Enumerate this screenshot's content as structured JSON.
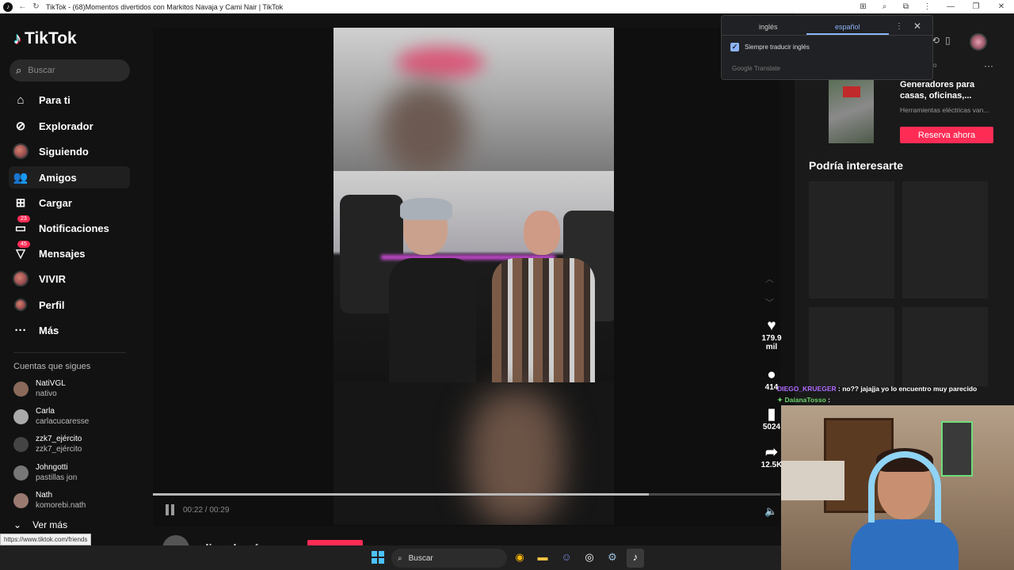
{
  "browser": {
    "title": "TikTok - (68)Momentos divertidos con Markitos Navaja y Cami Nair | TikTok",
    "status_url": "https://www.tiktok.com/friends"
  },
  "sidebar": {
    "brand": "TikTok",
    "search_placeholder": "Buscar",
    "nav": [
      {
        "label": "Para ti",
        "icon": "home-icon"
      },
      {
        "label": "Explorador",
        "icon": "compass-icon"
      },
      {
        "label": "Siguiendo",
        "icon": "avatar-icon"
      },
      {
        "label": "Amigos",
        "icon": "friends-icon"
      },
      {
        "label": "Cargar",
        "icon": "upload-icon"
      },
      {
        "label": "Notificaciones",
        "icon": "inbox-icon",
        "badge": "23"
      },
      {
        "label": "Mensajes",
        "icon": "messages-icon",
        "badge": "45"
      },
      {
        "label": "VIVIR",
        "icon": "live-icon"
      },
      {
        "label": "Perfil",
        "icon": "profile-icon"
      },
      {
        "label": "Más",
        "icon": "more-icon"
      }
    ],
    "following_heading": "Cuentas que sigues",
    "following": [
      {
        "name": "NatiVGL",
        "sub": "nativo"
      },
      {
        "name": "Carla",
        "sub": "carlacucaresse"
      },
      {
        "name": "zzk7_ejército",
        "sub": "zzk7_ejército"
      },
      {
        "name": "Johngotti",
        "sub": "pastillas jon"
      },
      {
        "name": "Nath",
        "sub": "komorebi.nath"
      }
    ],
    "see_more": "Ver más"
  },
  "player": {
    "time": "00:22 / 00:29",
    "progress": 0.79,
    "caption": "clips de cámara"
  },
  "actions": {
    "likes": "179.9\nmil",
    "likes_1": "179.9",
    "likes_2": "mil",
    "comments": "414",
    "saves": "5024",
    "shares": "12.5K"
  },
  "right": {
    "ad_title": "Generadores para casas, oficinas,...",
    "ad_subtitle": "Herramientas eléctricas van...",
    "ad_button": "Reserva ahora",
    "interest_heading": "Podría interesarte"
  },
  "translate": {
    "tab_source": "inglés",
    "tab_target": "español",
    "always": "Siempre traducir inglés",
    "footer": "Google Translate"
  },
  "chat": {
    "user1": "DIEGO_KRUEGER",
    "msg1": ": no?? jajajja yo lo encuentro muy parecido",
    "user2": "DaianaTosso",
    "msg2": ":"
  },
  "taskbar": {
    "search_placeholder": "Buscar"
  }
}
